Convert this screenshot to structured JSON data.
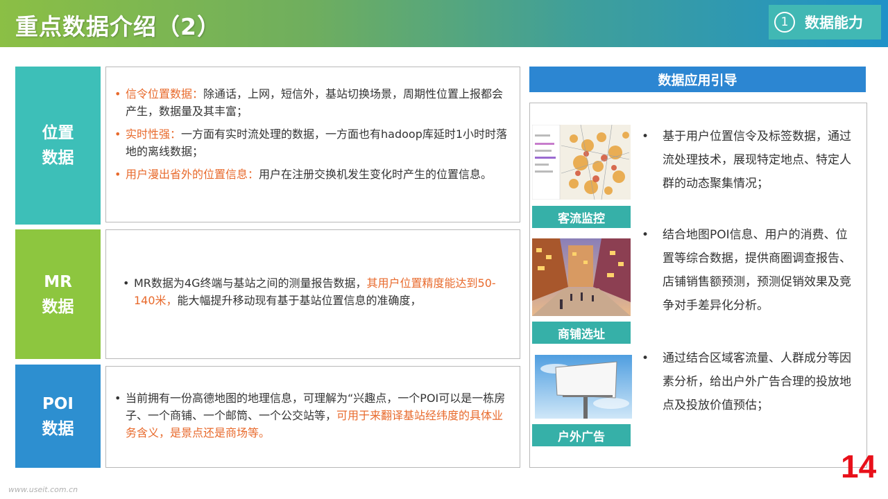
{
  "header": {
    "title": "重点数据介绍（2）",
    "section_number": "1",
    "section_label": "数据能力"
  },
  "blocks": [
    {
      "label_line1": "位置",
      "label_line2": "数据",
      "color": "#3dbfb8",
      "bullets": [
        {
          "highlight": "信令位置数据：",
          "text": "除通话，上网，短信外，基站切换场景，周期性位置上报都会产生，数据量及其丰富；"
        },
        {
          "highlight": "实时性强：",
          "text": "一方面有实时流处理的数据，一方面也有hadoop库延时1小时时落地的离线数据；"
        },
        {
          "highlight": "用户漫出省外的位置信息：",
          "text": "用户在注册交换机发生变化时产生的位置信息。"
        }
      ]
    },
    {
      "label_line1": "MR",
      "label_line2": "数据",
      "color": "#8dc63f",
      "text_a": "MR数据为4G终端与基站之间的测量报告数据，",
      "highlight": "其用户位置精度能达到50-140米，",
      "text_b": "能大幅提升移动现有基于基站位置信息的准确度，"
    },
    {
      "label_line1": "POI",
      "label_line2": "数据",
      "color": "#2d8fd0",
      "text_a": "当前拥有一份高德地图的地理信息，可理解为“兴趣点，一个POI可以是一栋房子、一个商铺、一个邮筒、一个公交站等，",
      "highlight": "可用于来翻译基站经纬度的具体业务含义，是景点还是商场等。"
    }
  ],
  "applications": {
    "title": "数据应用引导",
    "items": [
      {
        "caption": "客流监控",
        "text": "基于用户位置信令及标签数据，通过流处理技术，展现特定地点、特定人群的动态聚集情况；",
        "icon": "heatmap-thumbnail"
      },
      {
        "caption": "商铺选址",
        "text": "结合地图POI信息、用户的消费、位置等综合数据，提供商圈调查报告、店铺销售额预测，预测促销效果及竞争对手差异化分析。",
        "icon": "street-thumbnail"
      },
      {
        "caption": "户外广告",
        "text": "通过结合区域客流量、人群成分等因素分析，给出户外广告合理的投放地点及投放价值预估；",
        "icon": "billboard-thumbnail"
      }
    ]
  },
  "page_number": "14",
  "watermark": "www.useit.com.cn",
  "colors": {
    "accent_orange": "#e86a2c",
    "teal": "#36b0a8",
    "blue": "#2c86d2",
    "page_number_red": "#e8101a"
  }
}
